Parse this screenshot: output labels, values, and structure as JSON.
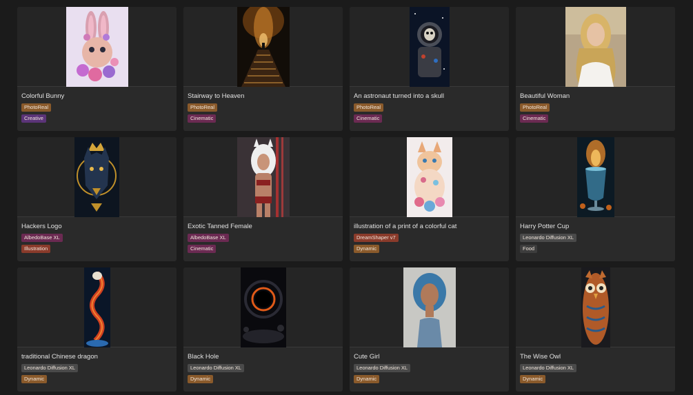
{
  "colors": {
    "page_bg": "#1b1b1b",
    "card_bg": "#2a2a2a",
    "tag_photoreal": "#8a5a2b",
    "tag_creative": "#5b3478",
    "tag_cinematic": "#6b2a52",
    "tag_albedo": "#6b2a52",
    "tag_illustration": "#8a3b2b",
    "tag_dreamshaper": "#8a3b2b",
    "tag_dynamic": "#8a5a2b",
    "tag_leonardo": "#4a4a4a",
    "tag_food": "#3d3d3d"
  },
  "cards": [
    {
      "title": "Colorful Bunny",
      "image": "bunny-image",
      "tags": [
        {
          "label": "PhotoReal",
          "color": "#8a5a2b"
        },
        {
          "label": "Creative",
          "color": "#5b3478"
        }
      ]
    },
    {
      "title": "Stairway to Heaven",
      "image": "stairway-image",
      "tags": [
        {
          "label": "PhotoReal",
          "color": "#8a5a2b"
        },
        {
          "label": "Cinematic",
          "color": "#6b2a52"
        }
      ]
    },
    {
      "title": "An astronaut turned into a skull",
      "image": "astronaut-image",
      "tags": [
        {
          "label": "PhotoReal",
          "color": "#8a5a2b"
        },
        {
          "label": "Cinematic",
          "color": "#6b2a52"
        }
      ]
    },
    {
      "title": "Beautiful Woman",
      "image": "woman-image",
      "tags": [
        {
          "label": "PhotoReal",
          "color": "#8a5a2b"
        },
        {
          "label": "Cinematic",
          "color": "#6b2a52"
        }
      ]
    },
    {
      "title": "Hackers Logo",
      "image": "wolf-logo-image",
      "tags": [
        {
          "label": "AlbedoBase XL",
          "color": "#6b2a52"
        },
        {
          "label": "Illustration",
          "color": "#8a3b2b"
        }
      ]
    },
    {
      "title": "Exotic Tanned Female",
      "image": "warrior-image",
      "tags": [
        {
          "label": "AlbedoBase XL",
          "color": "#6b2a52"
        },
        {
          "label": "Cinematic",
          "color": "#6b2a52"
        }
      ]
    },
    {
      "title": "illustration of a print of a colorful cat",
      "image": "cat-image",
      "tags": [
        {
          "label": "DreamShaper v7",
          "color": "#8a3b2b"
        },
        {
          "label": "Dynamic",
          "color": "#8a5a2b"
        }
      ]
    },
    {
      "title": "Harry Potter Cup",
      "image": "cup-image",
      "tags": [
        {
          "label": "Leonardo Diffusion XL",
          "color": "#4a4a4a"
        },
        {
          "label": "Food",
          "color": "#3d3d3d"
        }
      ]
    },
    {
      "title": "traditional Chinese dragon",
      "image": "dragon-image",
      "tags": [
        {
          "label": "Leonardo Diffusion XL",
          "color": "#4a4a4a"
        },
        {
          "label": "Dynamic",
          "color": "#8a5a2b"
        }
      ]
    },
    {
      "title": "Black Hole",
      "image": "black-hole-image",
      "tags": [
        {
          "label": "Leonardo Diffusion XL",
          "color": "#4a4a4a"
        },
        {
          "label": "Dynamic",
          "color": "#8a5a2b"
        }
      ]
    },
    {
      "title": "Cute Girl",
      "image": "girl-image",
      "tags": [
        {
          "label": "Leonardo Diffusion XL",
          "color": "#4a4a4a"
        },
        {
          "label": "Dynamic",
          "color": "#8a5a2b"
        }
      ]
    },
    {
      "title": "The Wise Owl",
      "image": "owl-image",
      "tags": [
        {
          "label": "Leonardo Diffusion XL",
          "color": "#4a4a4a"
        },
        {
          "label": "Dynamic",
          "color": "#8a5a2b"
        }
      ]
    }
  ]
}
